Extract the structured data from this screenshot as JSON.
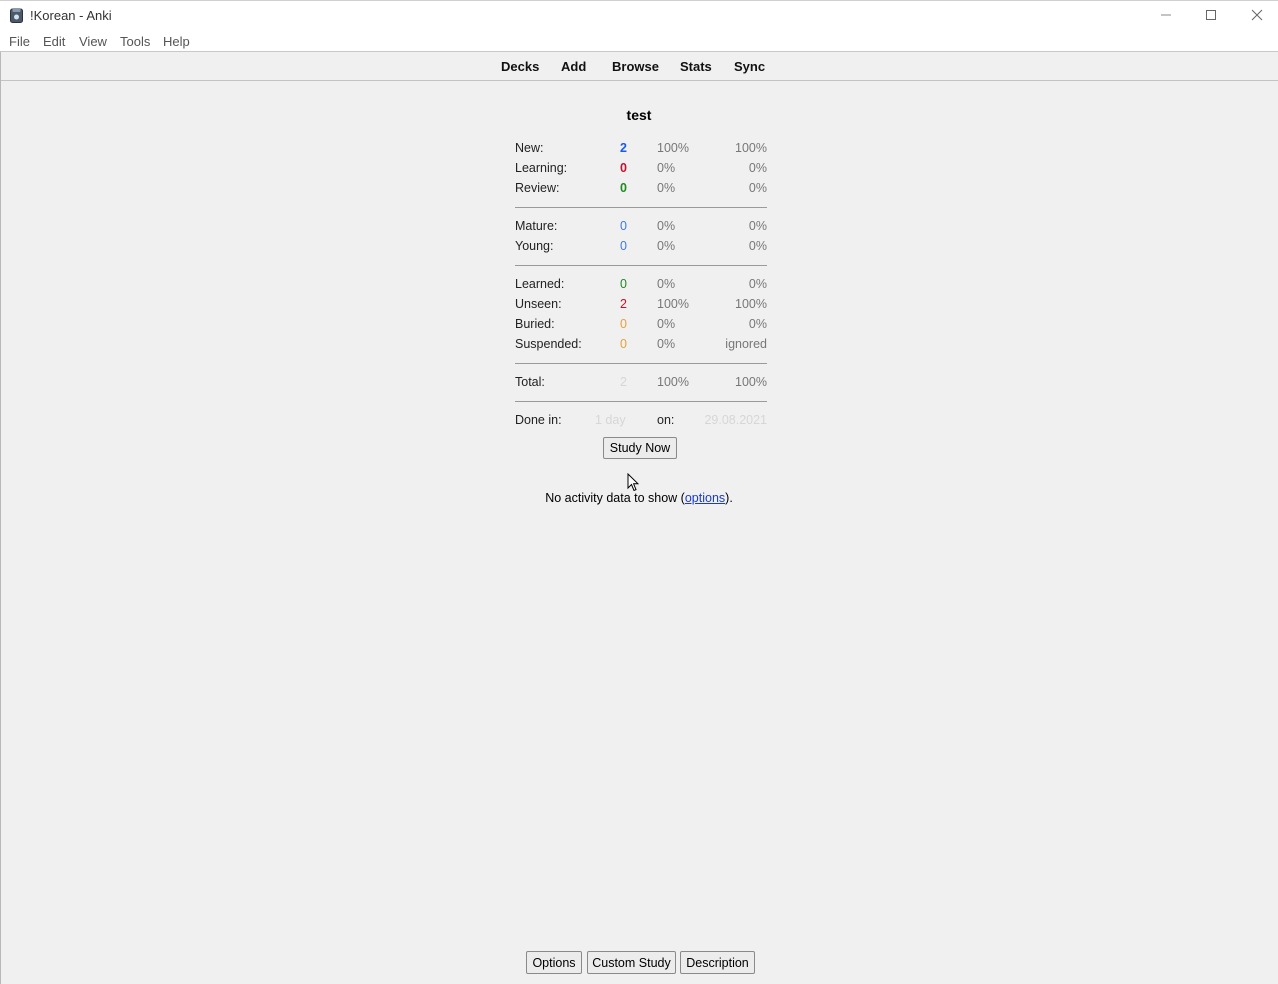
{
  "window": {
    "title": "!Korean - Anki",
    "controls": [
      "minimize-icon",
      "maximize-icon",
      "close-icon"
    ]
  },
  "menu": {
    "file": "File",
    "edit": "Edit",
    "view": "View",
    "tools": "Tools",
    "help": "Help"
  },
  "toolbar": {
    "decks": "Decks",
    "add": "Add",
    "browse": "Browse",
    "stats": "Stats",
    "sync": "Sync"
  },
  "deck": {
    "name": "test",
    "new": {
      "label": "New:",
      "count": "2",
      "pct": "100%",
      "pct2": "100%"
    },
    "learning": {
      "label": "Learning:",
      "count": "0",
      "pct": "0%",
      "pct2": "0%"
    },
    "review": {
      "label": "Review:",
      "count": "0",
      "pct": "0%",
      "pct2": "0%"
    },
    "mature": {
      "label": "Mature:",
      "count": "0",
      "pct": "0%",
      "pct2": "0%"
    },
    "young": {
      "label": "Young:",
      "count": "0",
      "pct": "0%",
      "pct2": "0%"
    },
    "learned": {
      "label": "Learned:",
      "count": "0",
      "pct": "0%",
      "pct2": "0%"
    },
    "unseen": {
      "label": "Unseen:",
      "count": "2",
      "pct": "100%",
      "pct2": "100%"
    },
    "buried": {
      "label": "Buried:",
      "count": "0",
      "pct": "0%",
      "pct2": "0%"
    },
    "suspended": {
      "label": "Suspended:",
      "count": "0",
      "pct": "0%",
      "pct2": "ignored"
    },
    "total": {
      "label": "Total:",
      "count": "2",
      "pct": "100%",
      "pct2": "100%"
    },
    "done": {
      "label": "Done in:",
      "value": "1 day",
      "on_label": "on:",
      "date": "29.08.2021"
    },
    "study_now": "Study Now"
  },
  "activity": {
    "text": "No activity data to show (",
    "link": "options",
    "after": ")."
  },
  "bottom": {
    "options": "Options",
    "custom_study": "Custom Study",
    "description": "Description"
  },
  "colors": {
    "new": "#1a5ce6",
    "learning": "#c8102e",
    "review": "#1f8a1f",
    "mature_young": "#3b7be8",
    "buried_suspended": "#e8a03b"
  }
}
